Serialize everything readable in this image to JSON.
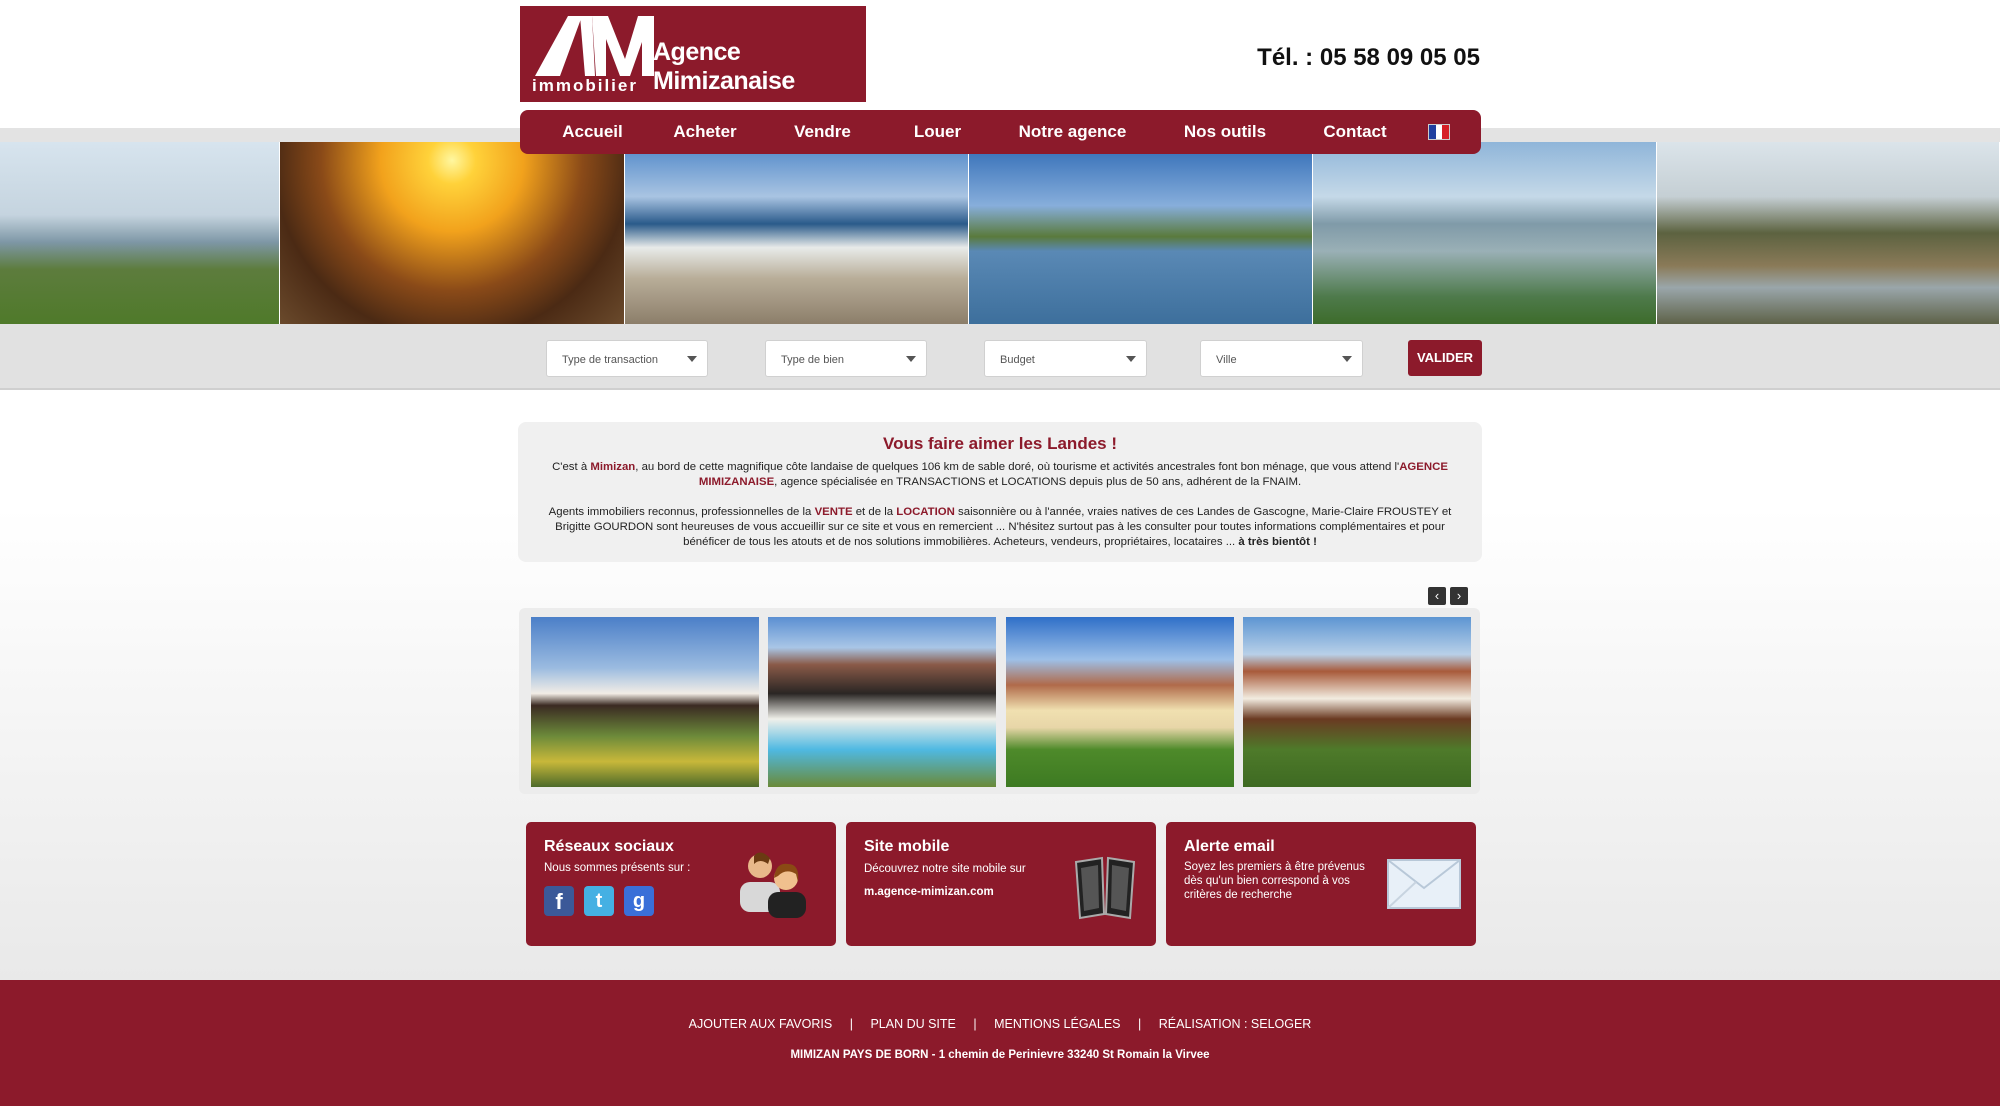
{
  "header": {
    "logo_letters": "AM",
    "logo_name": "Agence Mimizanaise",
    "logo_sub": "immobilier",
    "phone": "Tél. : 05 58 09 05 05"
  },
  "nav": {
    "items": [
      "Accueil",
      "Acheter",
      "Vendre",
      "Louer",
      "Notre agence",
      "Nos outils",
      "Contact"
    ],
    "flag_icon": "french-flag-icon"
  },
  "search": {
    "transaction": "Type de transaction",
    "type": "Type de bien",
    "budget": "Budget",
    "ville": "Ville",
    "submit": "VALIDER"
  },
  "intro": {
    "title": "Vous faire aimer les Landes !",
    "p1_a": "C'est à ",
    "p1_b": "Mimizan",
    "p1_c": ", au bord de cette magnifique côte landaise de quelques 106 km de sable doré, où tourisme et activités ancestrales font bon ménage, que vous attend l'",
    "p1_d": "AGENCE MIMIZANAISE",
    "p1_e": ", agence spécialisée en TRANSACTIONS et LOCATIONS depuis plus de 50 ans, adhérent de la FNAIM.",
    "p2_a": "Agents immobiliers reconnus, professionnelles de la ",
    "p2_b": "VENTE",
    "p2_c": " et de la ",
    "p2_d": "LOCATION",
    "p2_e": " saisonnière ou à l'année, vraies natives de ces Landes de Gascogne, Marie-Claire FROUSTEY et Brigitte GOURDON sont heureuses de vous accueillir sur ce site et vous en remercient ... N'hésitez surtout pas à les consulter pour toutes informations complémentaires et pour bénéficer de tous les atouts et de nos solutions immobilières. Acheteurs, vendeurs, propriétaires, locataires ... ",
    "p2_f": "à très bientôt !"
  },
  "carousel": {
    "prev": "‹",
    "next": "›"
  },
  "boxes": {
    "social_title": "Réseaux sociaux",
    "social_text": "Nous sommes présents sur :",
    "social_icons": [
      "facebook-icon",
      "twitter-icon",
      "google-icon"
    ],
    "mobile_title": "Site mobile",
    "mobile_text": "Découvrez notre site mobile sur",
    "mobile_url": "m.agence-mimizan.com",
    "alert_title": "Alerte email",
    "alert_text": "Soyez les premiers à être prévenus dès qu'un bien correspond à vos critères de recherche"
  },
  "footer": {
    "links": [
      "AJOUTER AUX FAVORIS",
      "PLAN DU SITE",
      "MENTIONS LÉGALES",
      "RÉALISATION : SELOGER"
    ],
    "separator": "|",
    "address": "MIMIZAN PAYS DE BORN - 1 chemin de Perinievre 33240 St Romain la Virvee"
  },
  "colors": {
    "brand": "#8c1a2b",
    "band": "#e1e1e1"
  }
}
